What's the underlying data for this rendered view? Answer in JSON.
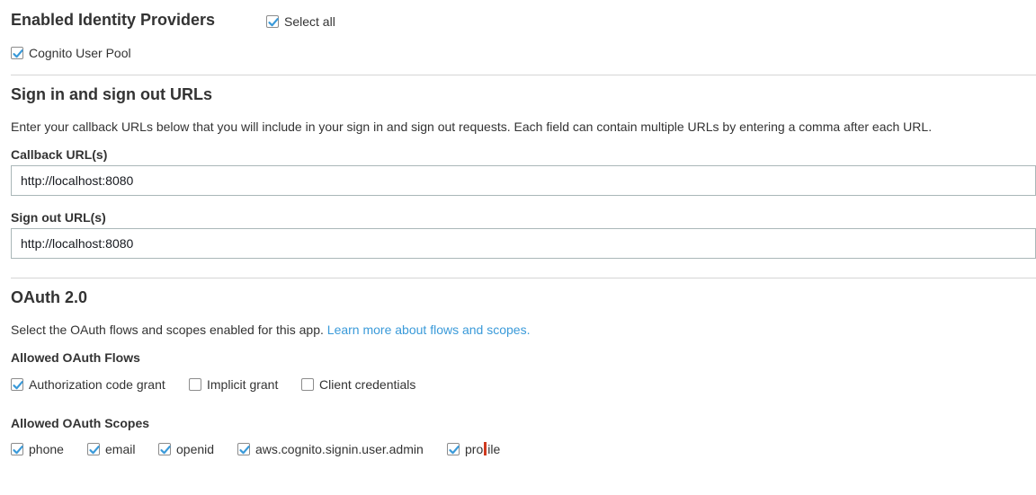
{
  "identity_providers": {
    "title": "Enabled Identity Providers",
    "select_all": {
      "label": "Select all",
      "checked": true
    },
    "providers": [
      {
        "label": "Cognito User Pool",
        "checked": true
      }
    ]
  },
  "sign_urls": {
    "title": "Sign in and sign out URLs",
    "description": "Enter your callback URLs below that you will include in your sign in and sign out requests. Each field can contain multiple URLs by entering a comma after each URL.",
    "callback_label": "Callback URL(s)",
    "callback_value": "http://localhost:8080",
    "signout_label": "Sign out URL(s)",
    "signout_value": "http://localhost:8080"
  },
  "oauth": {
    "title": "OAuth 2.0",
    "description": "Select the OAuth flows and scopes enabled for this app.",
    "learn_more": "Learn more about flows and scopes.",
    "flows_label": "Allowed OAuth Flows",
    "flows": [
      {
        "label": "Authorization code grant",
        "checked": true
      },
      {
        "label": "Implicit grant",
        "checked": false
      },
      {
        "label": "Client credentials",
        "checked": false
      }
    ],
    "scopes_label": "Allowed OAuth Scopes",
    "scopes": [
      {
        "label": "phone",
        "checked": true
      },
      {
        "label": "email",
        "checked": true
      },
      {
        "label": "openid",
        "checked": true
      },
      {
        "label": "aws.cognito.signin.user.admin",
        "checked": true
      },
      {
        "label_start": "pro",
        "label_end": "ile",
        "checked": true
      }
    ]
  },
  "colors": {
    "check_accent": "#3a9ad9",
    "link": "#3a9ad9",
    "divider": "#d5d5d5",
    "cursor_marker": "#cf3a1f"
  }
}
